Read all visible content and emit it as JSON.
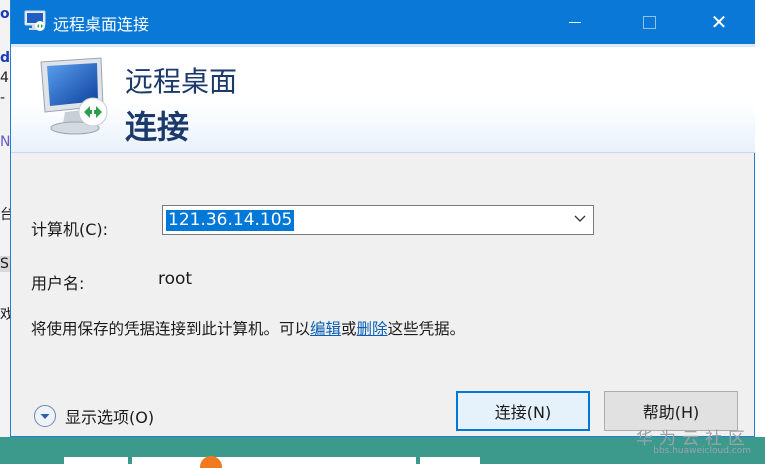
{
  "background": {
    "left_fragments": [
      "o",
      "d",
      "4",
      "-",
      "N",
      "台",
      "S",
      "戏"
    ]
  },
  "dialog": {
    "title": "远程桌面连接",
    "window_buttons": {
      "minimize": "—",
      "maximize": "☐",
      "close": "✕"
    },
    "header": {
      "line1": "远程桌面",
      "line2": "连接"
    },
    "computer_label": "计算机(C):",
    "computer_value": "121.36.14.105",
    "user_label": "用户名:",
    "user_value": "root",
    "info": {
      "prefix": "将使用保存的凭据连接到此计算机。可以",
      "edit_link": "编辑",
      "or": "或",
      "delete_link": "删除",
      "suffix": "这些凭据。"
    },
    "options_label": "显示选项(O)",
    "connect_button": "连接(N)",
    "help_button": "帮助(H)"
  },
  "watermark": {
    "main": "华为云社区",
    "sub": "bbs.huaweicloud.com"
  },
  "colors": {
    "titlebar": "#0a78d7",
    "header_text": "#1b3a6b",
    "selection": "#0078d7",
    "link": "#0a5fb4",
    "desktop": "#3c9a8c"
  }
}
